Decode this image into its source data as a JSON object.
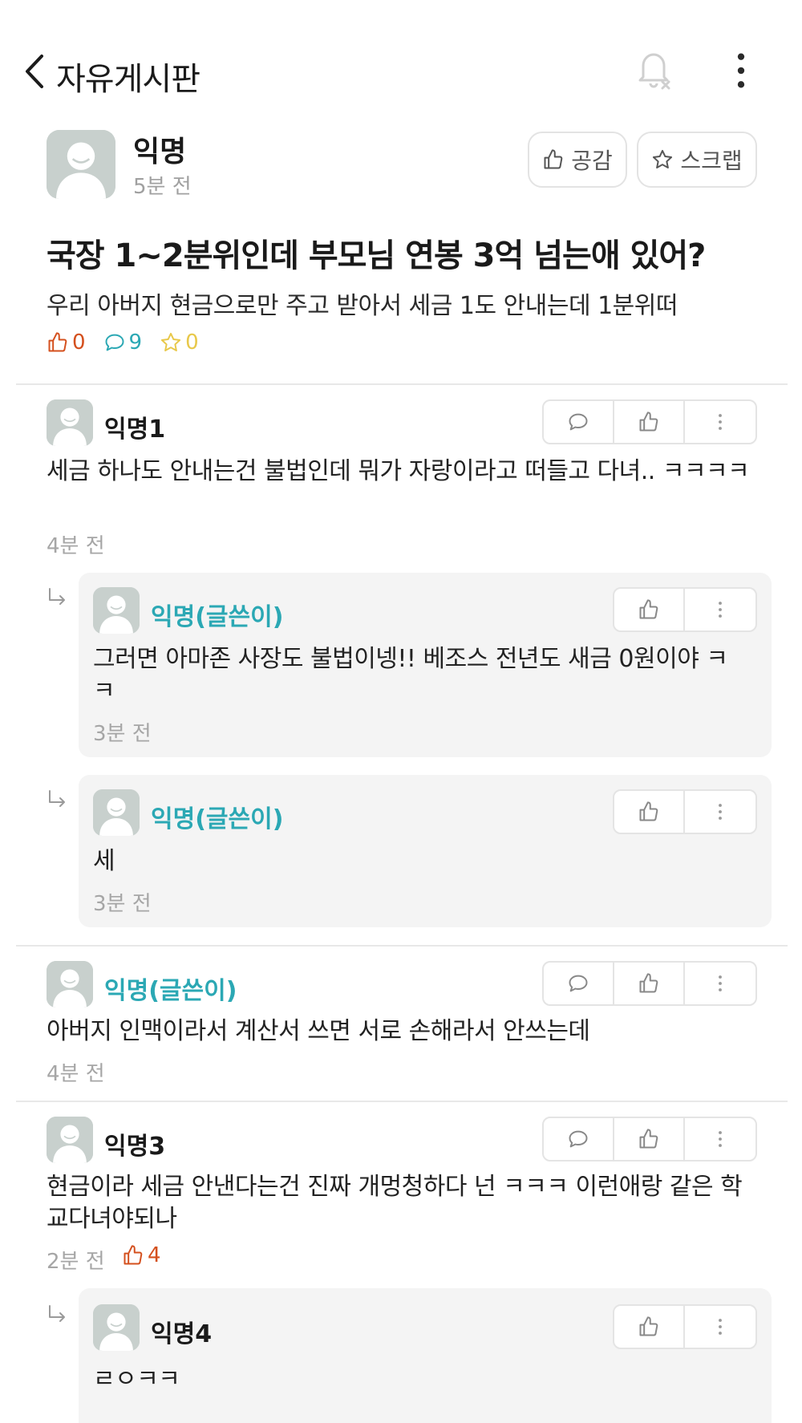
{
  "header": {
    "title": "자유게시판"
  },
  "post": {
    "author": "익명",
    "time": "5분 전",
    "like_button": "공감",
    "scrap_button": "스크랩",
    "title": "국장 1~2분위인데 부모님 연봉 3억 넘는애 있어?",
    "body": "우리 아버지 현금으로만 주고 받아서 세금 1도 안내는데 1분위떠",
    "stats": {
      "likes": "0",
      "comments": "9",
      "scraps": "0"
    }
  },
  "comments": [
    {
      "author": "익명1",
      "text": "세금 하나도 안내는건 불법인데 뭐가 자랑이라고 떠들고 다녀.. ㅋㅋㅋㅋ",
      "time": "4분 전"
    },
    {
      "author": "익명(글쓴이)",
      "text": "그러면 아마존 사장도 불법이넹!! 베조스 전년도 새금 0원이야 ㅋㅋ",
      "time": "3분 전"
    },
    {
      "author": "익명(글쓴이)",
      "text": "세",
      "time": "3분 전"
    },
    {
      "author": "익명(글쓴이)",
      "text": "아버지 인맥이라서 계산서 쓰면 서로 손해라서 안쓰는데",
      "time": "4분 전"
    },
    {
      "author": "익명3",
      "text": "현금이라 세금 안낸다는건 진짜 개멍청하다 넌 ㅋㅋㅋ 이런애랑 같은 학교다녀야되나",
      "time": "2분 전",
      "likes": "4"
    },
    {
      "author": "익명4",
      "text": "ㄹㅇㅋㅋ",
      "time": ""
    }
  ],
  "colors": {
    "op": "#2ba8b4",
    "like": "#d4501e",
    "scrap": "#e8c84a",
    "muted": "#a6a6a6"
  },
  "icons": [
    "back-icon",
    "bell-off-icon",
    "more-vertical-icon",
    "thumbs-up-icon",
    "star-icon",
    "comment-icon",
    "reply-arrow-icon"
  ]
}
